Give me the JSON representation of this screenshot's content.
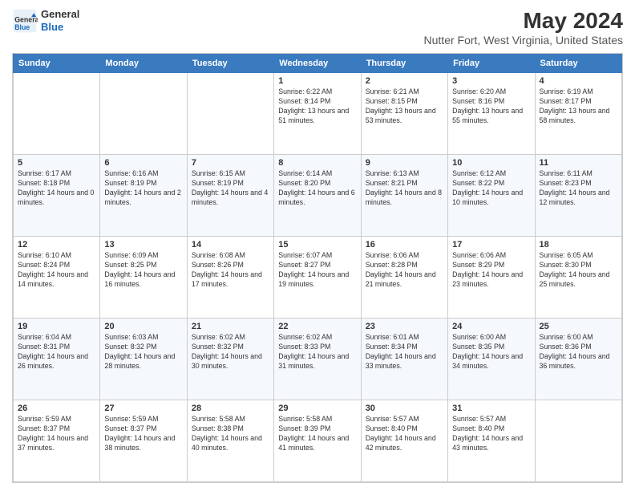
{
  "header": {
    "logo_line1": "General",
    "logo_line2": "Blue",
    "main_title": "May 2024",
    "subtitle": "Nutter Fort, West Virginia, United States"
  },
  "days_of_week": [
    "Sunday",
    "Monday",
    "Tuesday",
    "Wednesday",
    "Thursday",
    "Friday",
    "Saturday"
  ],
  "weeks": [
    [
      null,
      null,
      null,
      {
        "day": "1",
        "sunrise": "Sunrise: 6:22 AM",
        "sunset": "Sunset: 8:14 PM",
        "daylight": "Daylight: 13 hours and 51 minutes."
      },
      {
        "day": "2",
        "sunrise": "Sunrise: 6:21 AM",
        "sunset": "Sunset: 8:15 PM",
        "daylight": "Daylight: 13 hours and 53 minutes."
      },
      {
        "day": "3",
        "sunrise": "Sunrise: 6:20 AM",
        "sunset": "Sunset: 8:16 PM",
        "daylight": "Daylight: 13 hours and 55 minutes."
      },
      {
        "day": "4",
        "sunrise": "Sunrise: 6:19 AM",
        "sunset": "Sunset: 8:17 PM",
        "daylight": "Daylight: 13 hours and 58 minutes."
      }
    ],
    [
      {
        "day": "5",
        "sunrise": "Sunrise: 6:17 AM",
        "sunset": "Sunset: 8:18 PM",
        "daylight": "Daylight: 14 hours and 0 minutes."
      },
      {
        "day": "6",
        "sunrise": "Sunrise: 6:16 AM",
        "sunset": "Sunset: 8:19 PM",
        "daylight": "Daylight: 14 hours and 2 minutes."
      },
      {
        "day": "7",
        "sunrise": "Sunrise: 6:15 AM",
        "sunset": "Sunset: 8:19 PM",
        "daylight": "Daylight: 14 hours and 4 minutes."
      },
      {
        "day": "8",
        "sunrise": "Sunrise: 6:14 AM",
        "sunset": "Sunset: 8:20 PM",
        "daylight": "Daylight: 14 hours and 6 minutes."
      },
      {
        "day": "9",
        "sunrise": "Sunrise: 6:13 AM",
        "sunset": "Sunset: 8:21 PM",
        "daylight": "Daylight: 14 hours and 8 minutes."
      },
      {
        "day": "10",
        "sunrise": "Sunrise: 6:12 AM",
        "sunset": "Sunset: 8:22 PM",
        "daylight": "Daylight: 14 hours and 10 minutes."
      },
      {
        "day": "11",
        "sunrise": "Sunrise: 6:11 AM",
        "sunset": "Sunset: 8:23 PM",
        "daylight": "Daylight: 14 hours and 12 minutes."
      }
    ],
    [
      {
        "day": "12",
        "sunrise": "Sunrise: 6:10 AM",
        "sunset": "Sunset: 8:24 PM",
        "daylight": "Daylight: 14 hours and 14 minutes."
      },
      {
        "day": "13",
        "sunrise": "Sunrise: 6:09 AM",
        "sunset": "Sunset: 8:25 PM",
        "daylight": "Daylight: 14 hours and 16 minutes."
      },
      {
        "day": "14",
        "sunrise": "Sunrise: 6:08 AM",
        "sunset": "Sunset: 8:26 PM",
        "daylight": "Daylight: 14 hours and 17 minutes."
      },
      {
        "day": "15",
        "sunrise": "Sunrise: 6:07 AM",
        "sunset": "Sunset: 8:27 PM",
        "daylight": "Daylight: 14 hours and 19 minutes."
      },
      {
        "day": "16",
        "sunrise": "Sunrise: 6:06 AM",
        "sunset": "Sunset: 8:28 PM",
        "daylight": "Daylight: 14 hours and 21 minutes."
      },
      {
        "day": "17",
        "sunrise": "Sunrise: 6:06 AM",
        "sunset": "Sunset: 8:29 PM",
        "daylight": "Daylight: 14 hours and 23 minutes."
      },
      {
        "day": "18",
        "sunrise": "Sunrise: 6:05 AM",
        "sunset": "Sunset: 8:30 PM",
        "daylight": "Daylight: 14 hours and 25 minutes."
      }
    ],
    [
      {
        "day": "19",
        "sunrise": "Sunrise: 6:04 AM",
        "sunset": "Sunset: 8:31 PM",
        "daylight": "Daylight: 14 hours and 26 minutes."
      },
      {
        "day": "20",
        "sunrise": "Sunrise: 6:03 AM",
        "sunset": "Sunset: 8:32 PM",
        "daylight": "Daylight: 14 hours and 28 minutes."
      },
      {
        "day": "21",
        "sunrise": "Sunrise: 6:02 AM",
        "sunset": "Sunset: 8:32 PM",
        "daylight": "Daylight: 14 hours and 30 minutes."
      },
      {
        "day": "22",
        "sunrise": "Sunrise: 6:02 AM",
        "sunset": "Sunset: 8:33 PM",
        "daylight": "Daylight: 14 hours and 31 minutes."
      },
      {
        "day": "23",
        "sunrise": "Sunrise: 6:01 AM",
        "sunset": "Sunset: 8:34 PM",
        "daylight": "Daylight: 14 hours and 33 minutes."
      },
      {
        "day": "24",
        "sunrise": "Sunrise: 6:00 AM",
        "sunset": "Sunset: 8:35 PM",
        "daylight": "Daylight: 14 hours and 34 minutes."
      },
      {
        "day": "25",
        "sunrise": "Sunrise: 6:00 AM",
        "sunset": "Sunset: 8:36 PM",
        "daylight": "Daylight: 14 hours and 36 minutes."
      }
    ],
    [
      {
        "day": "26",
        "sunrise": "Sunrise: 5:59 AM",
        "sunset": "Sunset: 8:37 PM",
        "daylight": "Daylight: 14 hours and 37 minutes."
      },
      {
        "day": "27",
        "sunrise": "Sunrise: 5:59 AM",
        "sunset": "Sunset: 8:37 PM",
        "daylight": "Daylight: 14 hours and 38 minutes."
      },
      {
        "day": "28",
        "sunrise": "Sunrise: 5:58 AM",
        "sunset": "Sunset: 8:38 PM",
        "daylight": "Daylight: 14 hours and 40 minutes."
      },
      {
        "day": "29",
        "sunrise": "Sunrise: 5:58 AM",
        "sunset": "Sunset: 8:39 PM",
        "daylight": "Daylight: 14 hours and 41 minutes."
      },
      {
        "day": "30",
        "sunrise": "Sunrise: 5:57 AM",
        "sunset": "Sunset: 8:40 PM",
        "daylight": "Daylight: 14 hours and 42 minutes."
      },
      {
        "day": "31",
        "sunrise": "Sunrise: 5:57 AM",
        "sunset": "Sunset: 8:40 PM",
        "daylight": "Daylight: 14 hours and 43 minutes."
      },
      null
    ]
  ]
}
